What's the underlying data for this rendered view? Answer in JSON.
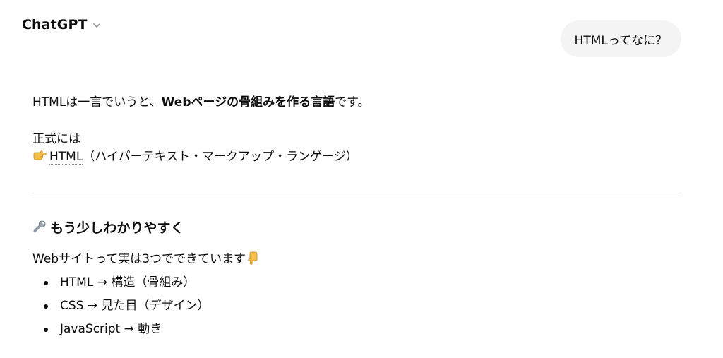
{
  "header": {
    "model_name": "ChatGPT"
  },
  "user_message": "HTMLってなに？",
  "response": {
    "intro_pre": "HTMLは一言でいうと、",
    "intro_bold": "Webページの骨組みを作る言語",
    "intro_post": "です。",
    "formal_label": "正式には",
    "formal_abbr": "HTML",
    "formal_expansion": "（ハイパーテキスト・マークアップ・ランゲージ）",
    "section_title": "もう少しわかりやすく",
    "section_lead": "Webサイトって実は3つでできています",
    "bullets": [
      "HTML → 構造（骨組み）",
      "CSS → 見た目（デザイン）",
      "JavaScript → 動き"
    ]
  },
  "icons": {
    "model_menu": "chevron-down-icon",
    "formal_pointer": "pointing-right-hand-icon",
    "section": "wrench-icon",
    "lead_pointer": "pointing-down-hand-icon"
  },
  "colors": {
    "text": "#0d0d0d",
    "user_bubble_bg": "#f4f4f4",
    "divider": "#dedede"
  }
}
